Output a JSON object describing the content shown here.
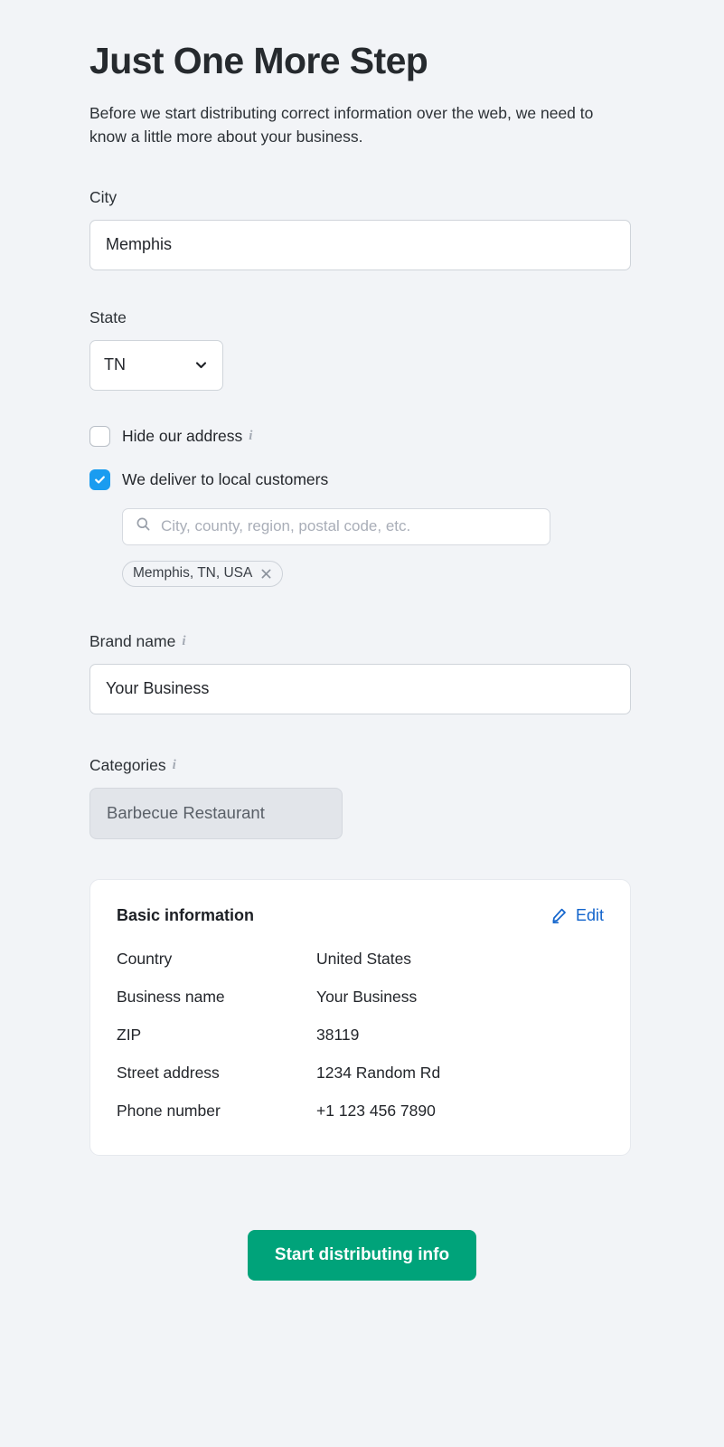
{
  "header": {
    "title": "Just One More Step",
    "subtitle": "Before we start distributing correct information over the web, we need to know a little more about your business."
  },
  "city": {
    "label": "City",
    "value": "Memphis"
  },
  "state": {
    "label": "State",
    "value": "TN",
    "chevron_icon": "chevron-down-icon"
  },
  "checkboxes": {
    "hide_address": {
      "label": "Hide our address",
      "checked": false,
      "info_icon": "info-icon",
      "info_glyph": "i"
    },
    "deliver_local": {
      "label": "We deliver to local customers",
      "checked": true
    }
  },
  "delivery": {
    "search_icon": "search-icon",
    "placeholder": "City, county, region, postal code, etc.",
    "value": "",
    "tags": [
      {
        "label": "Memphis, TN, USA",
        "remove_icon": "close-icon"
      }
    ]
  },
  "brand": {
    "label": "Brand name",
    "value": "Your Business",
    "info_glyph": "i"
  },
  "categories": {
    "label": "Categories",
    "info_glyph": "i",
    "items": [
      "Barbecue Restaurant"
    ]
  },
  "basic_info": {
    "title": "Basic information",
    "edit_label": "Edit",
    "edit_icon": "pencil-icon",
    "rows": [
      {
        "key": "Country",
        "value": "United States"
      },
      {
        "key": "Business name",
        "value": "Your Business"
      },
      {
        "key": "ZIP",
        "value": "38119"
      },
      {
        "key": "Street address",
        "value": "1234 Random Rd"
      },
      {
        "key": "Phone number",
        "value": "+1 123 456 7890"
      }
    ]
  },
  "submit": {
    "label": "Start distributing info"
  },
  "colors": {
    "background": "#f2f4f7",
    "checkbox_checked": "#1a9cf0",
    "link": "#1264cc",
    "submit": "#00a37a",
    "chip": "#e2e5ea"
  }
}
